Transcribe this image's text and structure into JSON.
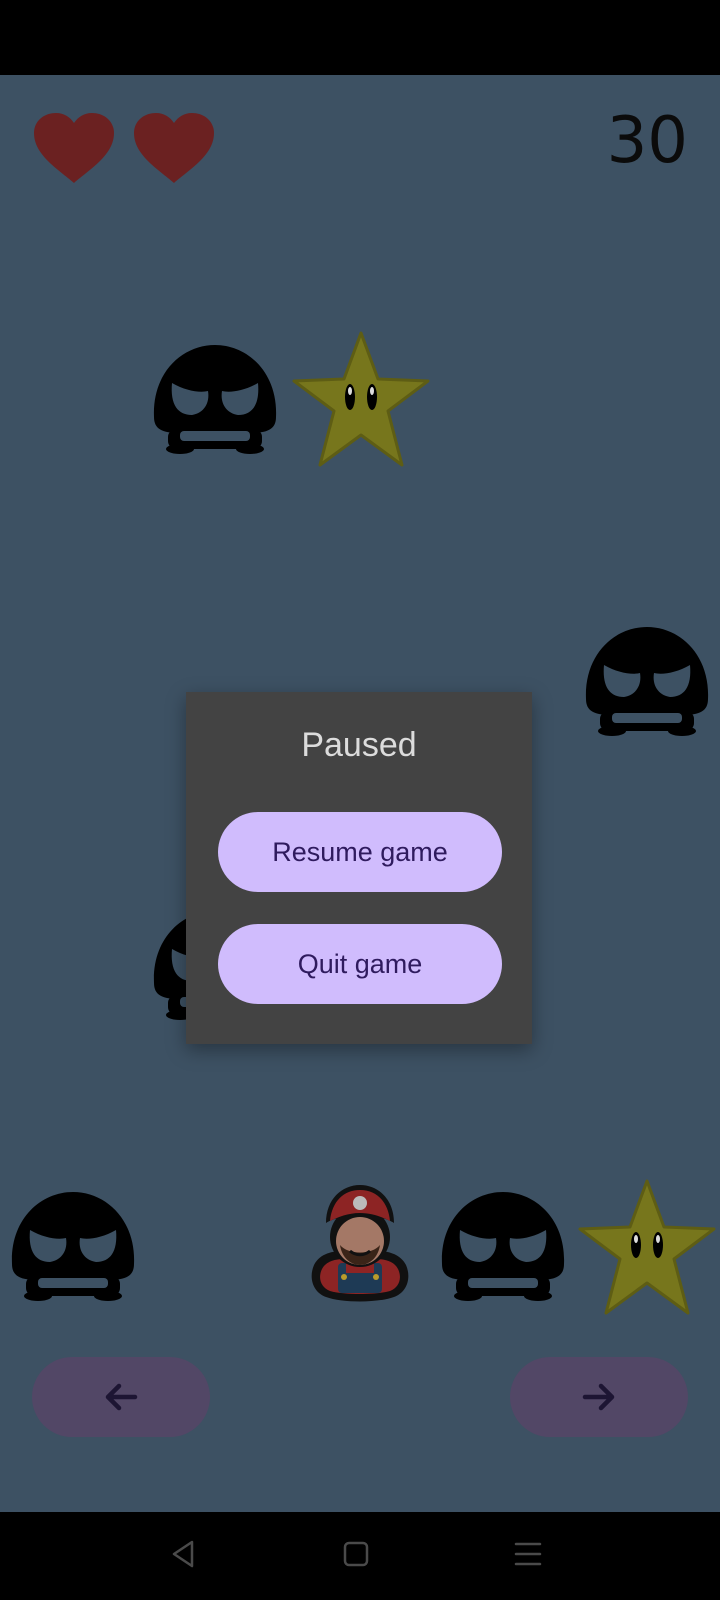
{
  "hud": {
    "score": "30",
    "lives": 2
  },
  "pause_dialog": {
    "title": "Paused",
    "resume_label": "Resume game",
    "quit_label": "Quit game"
  },
  "controls": {
    "left_icon": "arrow-left-icon",
    "right_icon": "arrow-right-icon"
  },
  "system_nav": {
    "icons": [
      "back-icon",
      "home-icon",
      "menu-icon"
    ]
  },
  "colors": {
    "game_background": "#3d5163",
    "heart": "#6b2121",
    "dialog_background": "#434343",
    "dialog_button": "#d0bcfd",
    "dialog_button_text": "#2f1b5e",
    "control_button": "#524766"
  }
}
